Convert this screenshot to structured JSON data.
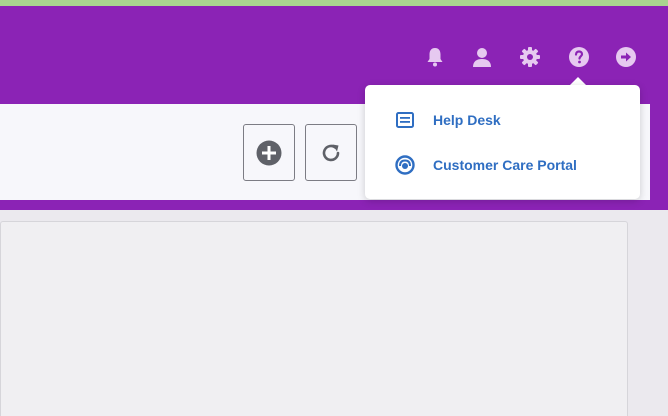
{
  "colors": {
    "header_bg": "#8b23b5",
    "header_icon": "#e6c9f0",
    "menu_text": "#2f6ec2",
    "tool_icon": "#5f6168"
  },
  "header": {
    "icons": [
      "bell-icon",
      "user-icon",
      "gear-icon",
      "help-icon",
      "sign-out-icon"
    ]
  },
  "toolbar": {
    "buttons": [
      "add-icon",
      "refresh-icon"
    ]
  },
  "help_menu": {
    "items": [
      {
        "icon": "document-icon",
        "label": "Help Desk"
      },
      {
        "icon": "headset-icon",
        "label": "Customer Care Portal"
      }
    ]
  }
}
